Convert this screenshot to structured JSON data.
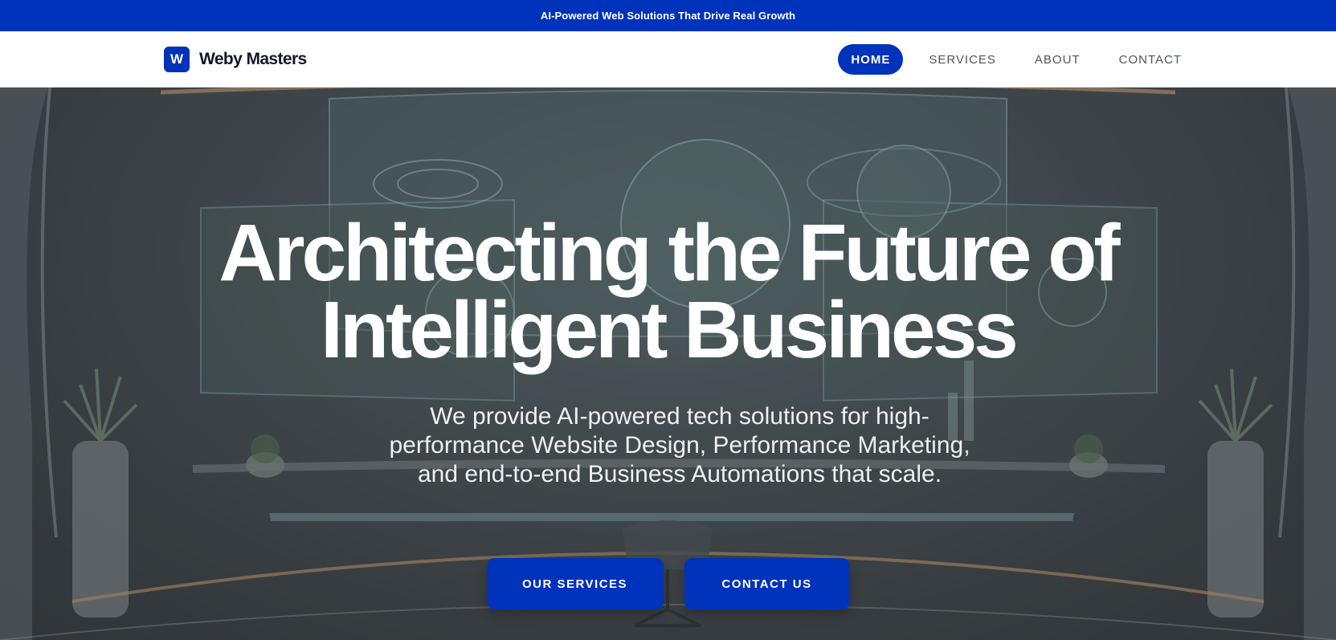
{
  "announcement": {
    "text": "AI-Powered Web Solutions That Drive Real Growth"
  },
  "brand": {
    "logo_letter": "W",
    "name": "Weby Masters"
  },
  "nav": {
    "items": [
      {
        "label": "HOME",
        "active": true
      },
      {
        "label": "SERVICES",
        "active": false
      },
      {
        "label": "ABOUT",
        "active": false
      },
      {
        "label": "CONTACT",
        "active": false
      }
    ]
  },
  "hero": {
    "headline_line1": "Architecting the Future of",
    "headline_line2": "Intelligent Business",
    "subtext": "We provide AI-powered tech solutions for high-performance Website Design, Performance Marketing, and end-to-end Business Automations that scale.",
    "buttons": {
      "services": "OUR SERVICES",
      "contact": "CONTACT US"
    }
  },
  "colors": {
    "accent": "#0033bb",
    "nav_text": "#4b5563",
    "brand_text": "#111827"
  }
}
